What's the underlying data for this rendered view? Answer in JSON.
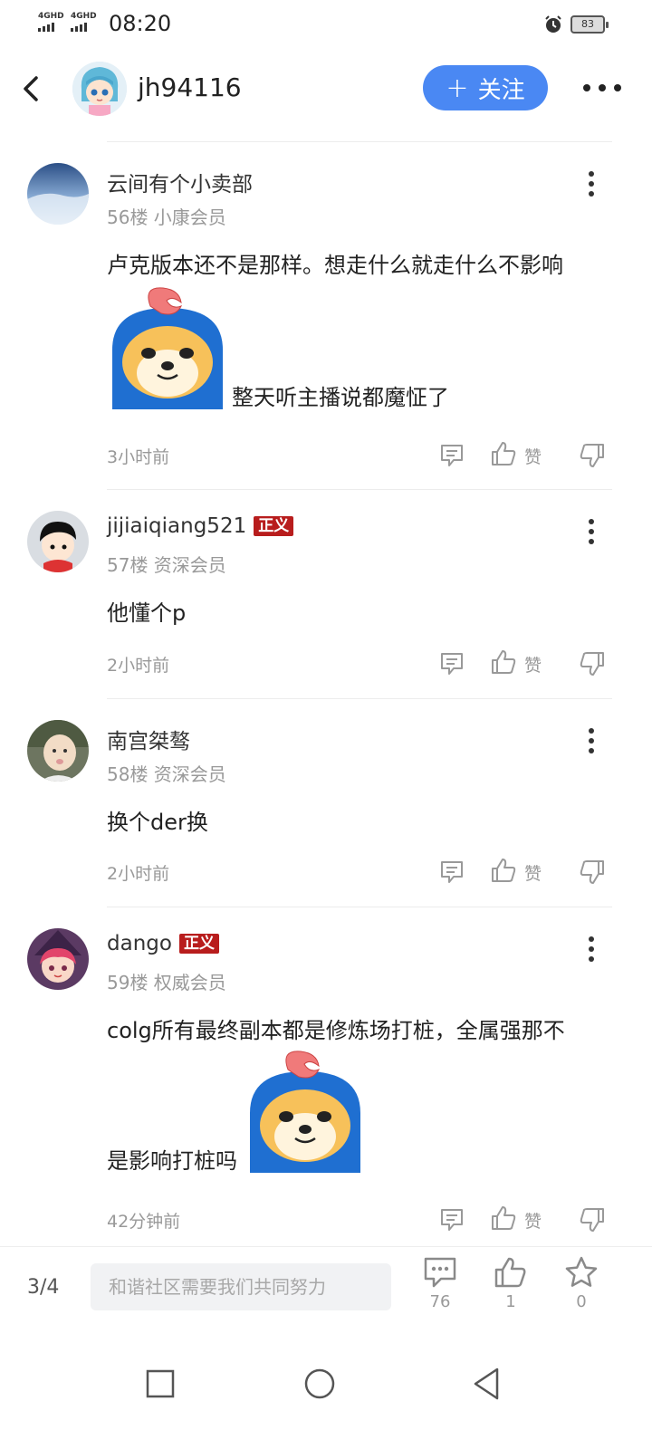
{
  "status_bar": {
    "signal_1": "4GHD",
    "signal_2": "4GHD",
    "time": "08:20",
    "battery": "83",
    "icons": [
      "alarm-icon",
      "battery-icon"
    ]
  },
  "header": {
    "username": "jh94116",
    "follow_plus": "+",
    "follow_label": "关注",
    "accent_color": "#4a88f3"
  },
  "posts": [
    {
      "username": "云间有个小卖部",
      "badge": "",
      "meta": "56楼 小康会员",
      "content_before": "卢克版本还不是那样。想走什么就走什么不影响",
      "content_after": "整天听主播说都魔怔了",
      "time": "3小时前",
      "like_label": "赞"
    },
    {
      "username": "jijiaiqiang521",
      "badge": "正义",
      "meta": "57楼 资深会员",
      "content": "他懂个p",
      "time": "2小时前",
      "like_label": "赞"
    },
    {
      "username": "南宫桀骜",
      "badge": "",
      "meta": "58楼 资深会员",
      "content": "换个der换",
      "time": "2小时前",
      "like_label": "赞"
    },
    {
      "username": "dango",
      "badge": "正义",
      "meta": "59楼 权威会员",
      "content_before": "colg所有最终副本都是修炼场打桩，全属强那不",
      "content_after": "是影响打桩吗",
      "time": "42分钟前",
      "like_label": "赞"
    }
  ],
  "bottom_bar": {
    "page_indicator": "3/4",
    "input_placeholder": "和谐社区需要我们共同努力",
    "comment_count": "76",
    "like_count": "1",
    "favorite_count": "0"
  },
  "badge_color": "#b81d1d"
}
